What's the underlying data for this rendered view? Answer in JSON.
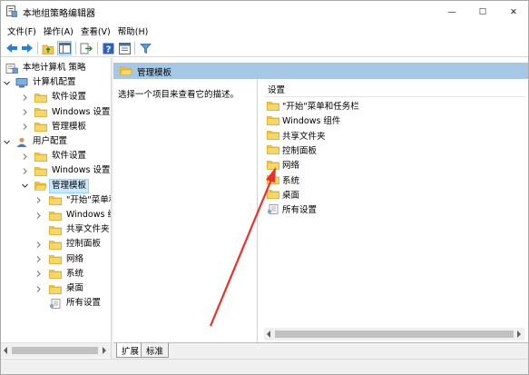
{
  "window": {
    "title": "本地组策略编辑器",
    "min_glyph": "—",
    "max_glyph": "☐",
    "close_glyph": "✕"
  },
  "menu": [
    "文件(F)",
    "操作(A)",
    "查看(V)",
    "帮助(H)"
  ],
  "toolbar": {
    "icons": [
      "back-icon",
      "forward-icon",
      "up-folder-icon",
      "show-tree-icon",
      "export-list-icon",
      "help-icon",
      "properties-icon",
      "filter-icon"
    ]
  },
  "tree": {
    "items": [
      {
        "label": "本地计算机 策略",
        "icon": "policy-icon",
        "level": 0,
        "expander": ""
      },
      {
        "label": "计算机配置",
        "icon": "computer-icon",
        "level": 1,
        "expander": "open"
      },
      {
        "label": "软件设置",
        "icon": "folder-icon",
        "level": 2,
        "expander": "closed"
      },
      {
        "label": "Windows 设置",
        "icon": "folder-icon",
        "level": 2,
        "expander": "closed"
      },
      {
        "label": "管理模板",
        "icon": "folder-icon",
        "level": 2,
        "expander": "closed"
      },
      {
        "label": "用户配置",
        "icon": "user-icon",
        "level": 1,
        "expander": "open"
      },
      {
        "label": "软件设置",
        "icon": "folder-icon",
        "level": 2,
        "expander": "closed"
      },
      {
        "label": "Windows 设置",
        "icon": "folder-icon",
        "level": 2,
        "expander": "closed"
      },
      {
        "label": "管理模板",
        "icon": "folder-open-icon",
        "level": 2,
        "expander": "open",
        "selected": true
      },
      {
        "label": "\"开始\"菜单和",
        "icon": "folder-icon",
        "level": 3,
        "expander": "closed"
      },
      {
        "label": "Windows 组",
        "icon": "folder-icon",
        "level": 3,
        "expander": "closed"
      },
      {
        "label": "共享文件夹",
        "icon": "folder-icon",
        "level": 3,
        "expander": ""
      },
      {
        "label": "控制面板",
        "icon": "folder-icon",
        "level": 3,
        "expander": "closed"
      },
      {
        "label": "网络",
        "icon": "folder-icon",
        "level": 3,
        "expander": "closed"
      },
      {
        "label": "系统",
        "icon": "folder-icon",
        "level": 3,
        "expander": "closed"
      },
      {
        "label": "桌面",
        "icon": "folder-icon",
        "level": 3,
        "expander": "closed"
      },
      {
        "label": "所有设置",
        "icon": "all-settings-icon",
        "level": 3,
        "expander": ""
      }
    ]
  },
  "right": {
    "header": "管理模板",
    "description": "选择一个项目来查看它的描述。",
    "column_header": "设置",
    "items": [
      {
        "label": "\"开始\"菜单和任务栏",
        "icon": "folder-icon"
      },
      {
        "label": "Windows 组件",
        "icon": "folder-icon"
      },
      {
        "label": "共享文件夹",
        "icon": "folder-icon"
      },
      {
        "label": "控制面板",
        "icon": "folder-icon"
      },
      {
        "label": "网络",
        "icon": "folder-icon"
      },
      {
        "label": "系统",
        "icon": "folder-icon"
      },
      {
        "label": "桌面",
        "icon": "folder-icon"
      },
      {
        "label": "所有设置",
        "icon": "all-settings-icon"
      }
    ]
  },
  "tabs": [
    {
      "label": "扩展",
      "active": true
    },
    {
      "label": "标准",
      "active": false
    }
  ],
  "colors": {
    "header_bg": "#a6c8e6",
    "selection_bg": "#cce8ff",
    "annotation_arrow": "#e8302c",
    "folder": "#f3c94b"
  }
}
